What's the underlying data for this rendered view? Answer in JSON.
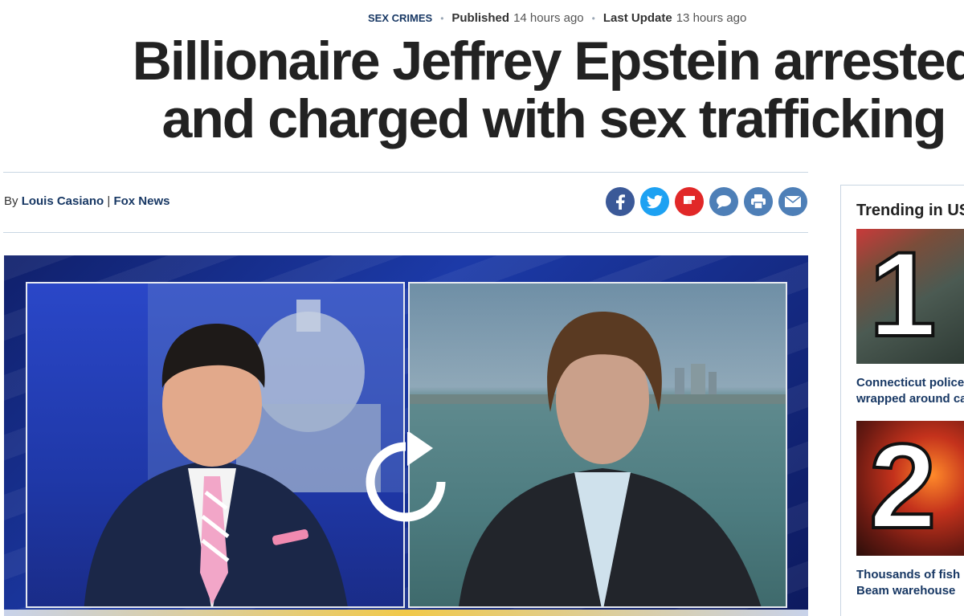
{
  "meta": {
    "category": "SEX CRIMES",
    "published_label": "Published",
    "published_value": "14 hours ago",
    "updated_label": "Last Update",
    "updated_value": "13 hours ago",
    "separator": "•"
  },
  "article": {
    "headline_line1": "Billionaire Jeffrey Epstein arrested",
    "headline_line2": "and charged with sex trafficking"
  },
  "byline": {
    "prefix": "By",
    "author": "Louis Casiano",
    "separator": "|",
    "outlet": "Fox News"
  },
  "share": {
    "buttons": [
      {
        "name": "facebook-icon",
        "color": "#3b5998"
      },
      {
        "name": "twitter-icon",
        "color": "#1da1f2"
      },
      {
        "name": "flipboard-icon",
        "color": "#e12828"
      },
      {
        "name": "comments-icon",
        "color": "#4e7fb7"
      },
      {
        "name": "print-icon",
        "color": "#4e7fb7"
      },
      {
        "name": "email-icon",
        "color": "#4e7fb7"
      }
    ]
  },
  "video": {
    "control_icon": "replay-icon"
  },
  "sidebar": {
    "title": "Trending in US",
    "items": [
      {
        "rank": "1",
        "headline": "Connecticut police",
        "headline2": "wrapped around ca"
      },
      {
        "rank": "2",
        "headline": "Thousands of fish p",
        "headline2": "Beam warehouse"
      }
    ]
  },
  "colors": {
    "link_navy": "#183864",
    "divider": "#c9d6e3",
    "headline": "#222222"
  }
}
